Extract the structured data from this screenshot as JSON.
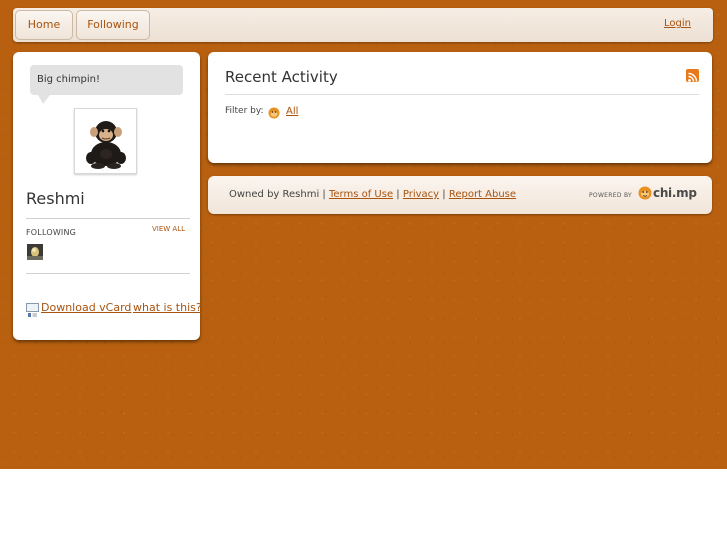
{
  "nav": {
    "tabs": [
      {
        "label": "Home"
      },
      {
        "label": "Following"
      }
    ],
    "login_label": "Login"
  },
  "profile": {
    "status_message": "Big chimpin!",
    "avatar_icon": "chimp-plush-photo",
    "name": "Reshmi",
    "following_label": "FOLLOWING",
    "view_all_label": "VIEW ALL",
    "following_thumb_icon": "followed-user-avatar",
    "download_vcard_label": "Download vCard",
    "what_is_this_label": "what is this?",
    "vcard_icon": "vcard-icon"
  },
  "activity": {
    "title": "Recent Activity",
    "rss_icon": "rss-icon",
    "filter_label": "Filter by:",
    "filter_icon": "chimp-face-icon",
    "filter_all_label": "All"
  },
  "footer": {
    "owned_by": "Owned by Reshmi |",
    "terms_label": "Terms of Use",
    "sep1": "|",
    "privacy_label": "Privacy",
    "sep2": "|",
    "report_label": "Report Abuse",
    "powered_by": "POWERED BY",
    "brand": "chi.mp"
  },
  "colors": {
    "background": "#b8600f",
    "link": "#a8530f",
    "panel": "#ffffff"
  }
}
